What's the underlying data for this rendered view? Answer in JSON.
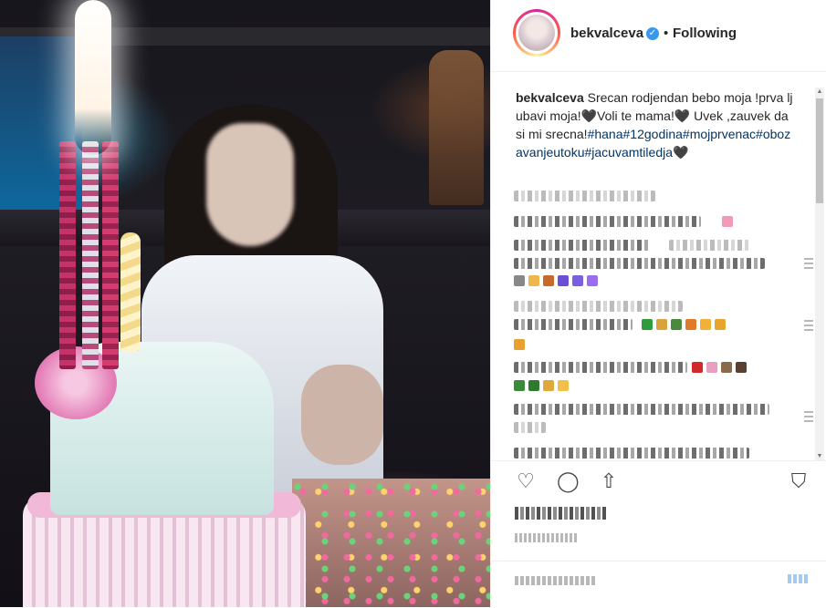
{
  "post": {
    "username": "bekvalceva",
    "verified_icon": "✓",
    "separator": "•",
    "follow_status": "Following",
    "caption": {
      "username": "bekvalceva",
      "text": " Srecan rodjendan bebo moja !prva ljubavi moja!🖤Voli te mama!🖤 Uvek ,zauvek da si mi srecna!",
      "hashtags": "#hana#12godina#mojprvenac#obozavanjeutoku#jacuvamtiledja🖤"
    }
  },
  "icons": {
    "like": "heart-icon",
    "comment": "comment-icon",
    "share": "share-icon",
    "save": "bookmark-icon",
    "verified": "verified-badge-icon"
  },
  "action_glyphs": {
    "like": "♡",
    "comment": "◯",
    "share": "⇧",
    "save": "⛉"
  },
  "scroll_glyphs": {
    "up": "▲",
    "down": "▼"
  },
  "colors": {
    "text": "#262626",
    "hashtag": "#003569",
    "verified": "#3897f0",
    "border": "#efefef"
  }
}
